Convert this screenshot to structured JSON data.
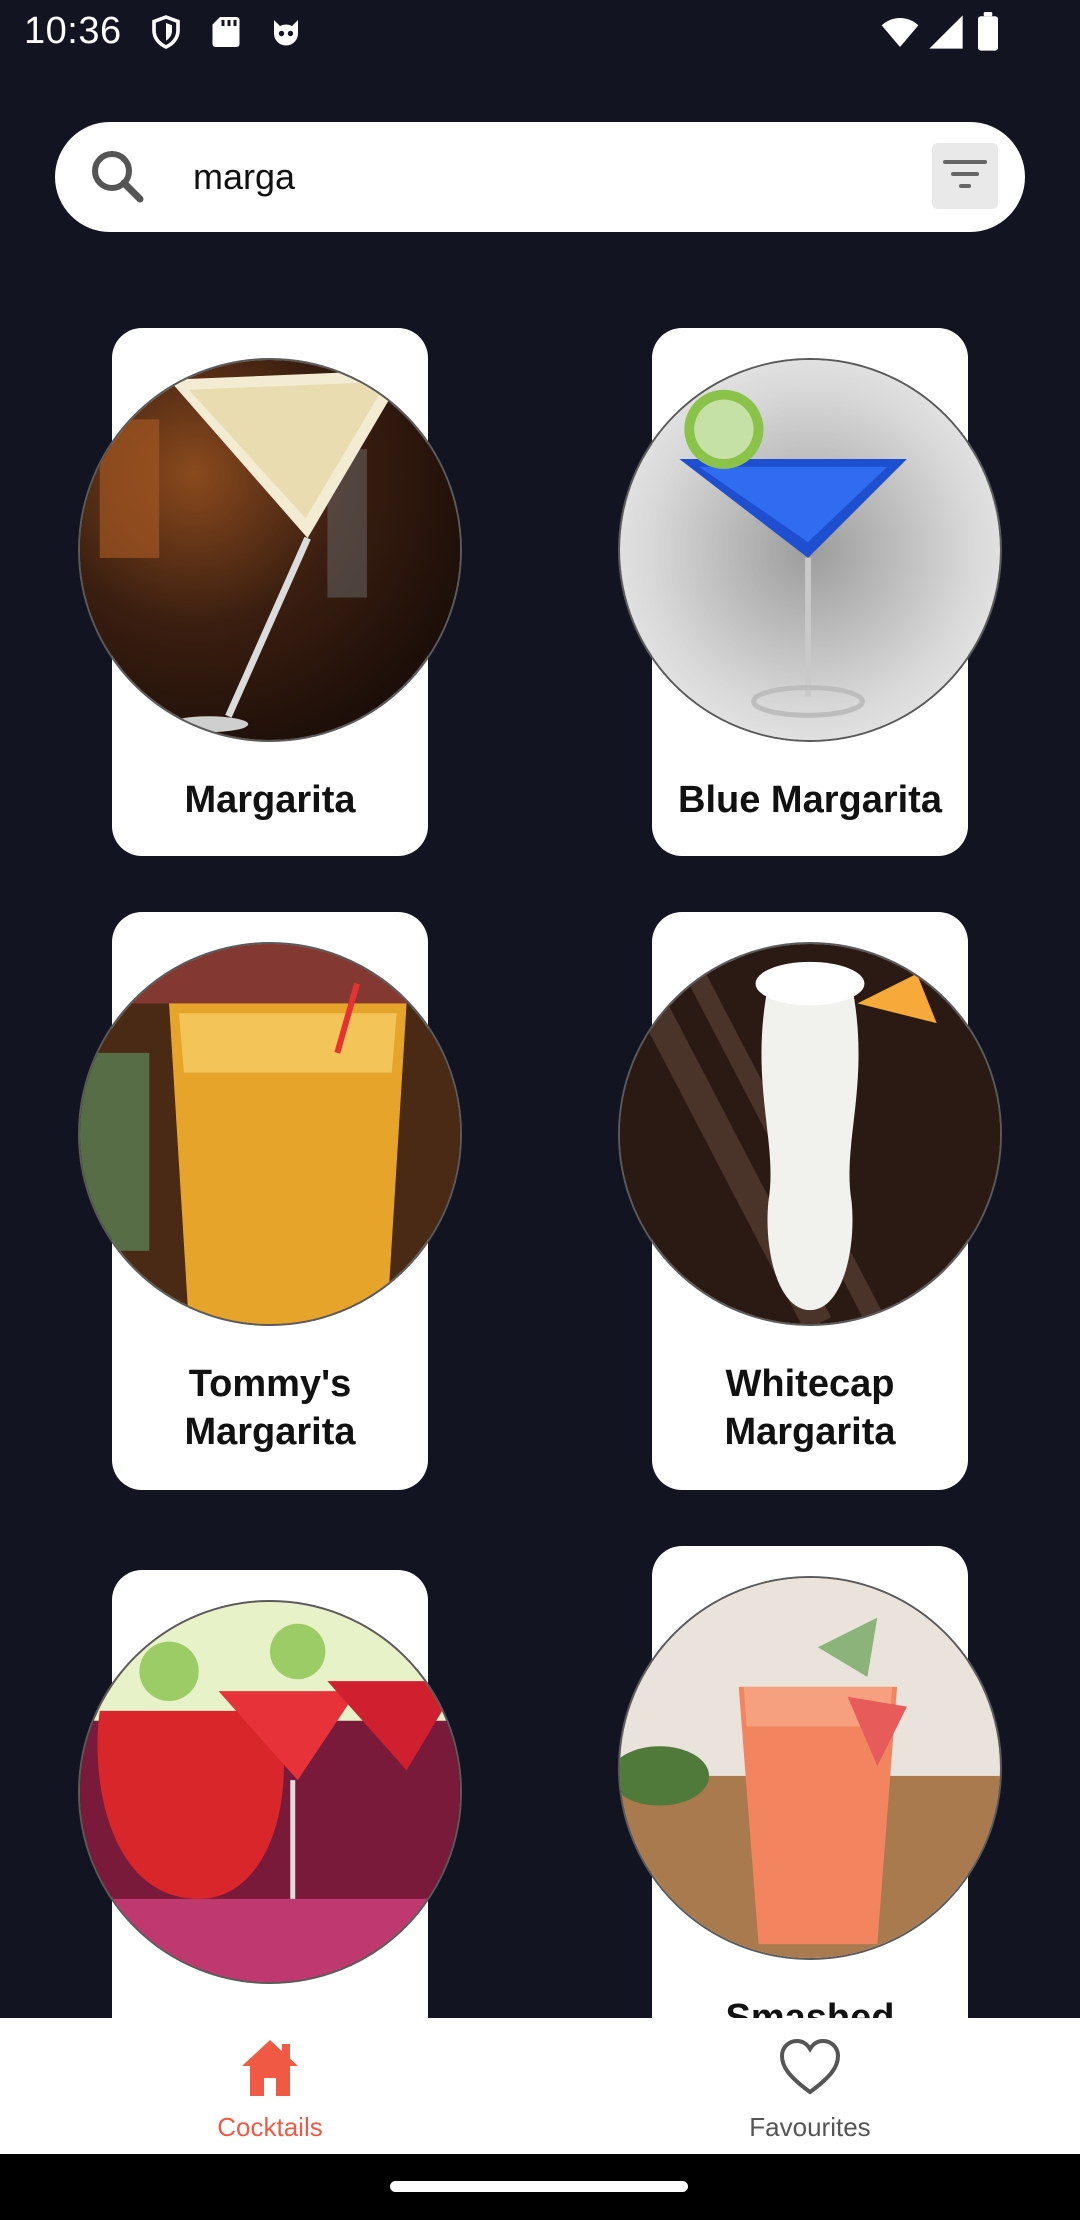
{
  "status_bar": {
    "time": "10:36",
    "left_icons": [
      "shield-icon",
      "sd-card-icon",
      "cat-face-icon"
    ],
    "right_icons": [
      "wifi-icon",
      "signal-icon",
      "battery-icon"
    ]
  },
  "search": {
    "value": "marga",
    "placeholder": ""
  },
  "cocktails": [
    {
      "name": "Margarita"
    },
    {
      "name": "Blue Margarita"
    },
    {
      "name": "Tommy's Margarita"
    },
    {
      "name": "Whitecap Margarita"
    },
    {
      "name": ""
    },
    {
      "name": "Smashed"
    }
  ],
  "bottom_nav": {
    "items": [
      {
        "label": "Cocktails",
        "icon": "home-icon",
        "active": true
      },
      {
        "label": "Favourites",
        "icon": "heart-icon",
        "active": false
      }
    ]
  },
  "colors": {
    "background": "#121421",
    "card": "#ffffff",
    "active_nav": "#f05a44",
    "inactive_nav": "#555555"
  }
}
